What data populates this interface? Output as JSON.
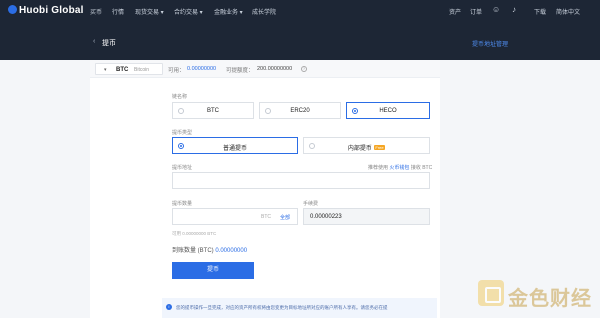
{
  "nav": {
    "logo": "Huobi Global",
    "items": [
      "买币",
      "行情",
      "现货交易 ▾",
      "合约交易 ▾",
      "金融业务 ▾",
      "成长学院"
    ],
    "right": {
      "assets": "资产",
      "orders": "订单",
      "download": "下载",
      "language": "简体中文"
    }
  },
  "header": {
    "back": "‹",
    "title": "提币",
    "addr_mgmt": "提币地址管理"
  },
  "coin": {
    "symbol": "BTC",
    "name": "Bitcoin",
    "available_label": "可用：",
    "available_value": "0.00000000",
    "limit_label": "可提额度：",
    "limit_value": "200.00000000"
  },
  "chain": {
    "label": "链名称",
    "options": [
      "BTC",
      "ERC20",
      "HECO"
    ],
    "selected": 2
  },
  "type": {
    "label": "提币类型",
    "options": [
      "普通提币",
      "内部提币"
    ],
    "new_tag": "Free",
    "selected": 0
  },
  "address": {
    "label": "提币地址",
    "hint_prefix": "推荐使用",
    "hint_link": "火币钱包",
    "hint_suffix": "接收 BTC",
    "value": ""
  },
  "amount": {
    "label": "提币数量",
    "unit": "BTC",
    "all": "全部",
    "min": "可用 0.00000000 BTC"
  },
  "fee": {
    "label": "手续费",
    "value": "0.00000223"
  },
  "receive": {
    "label": "到账数量 (BTC)",
    "value": "0.00000000"
  },
  "submit_label": "提币",
  "notice": "您的提币操作一旦完成，对应的资产所有权将由您变更为目标地址所对应的账户所有人享有。请您务必在提",
  "watermark": "金色财经",
  "colors": {
    "accent": "#2b6de5",
    "nav_bg": "#1d2635",
    "tag": "#f5a623"
  }
}
